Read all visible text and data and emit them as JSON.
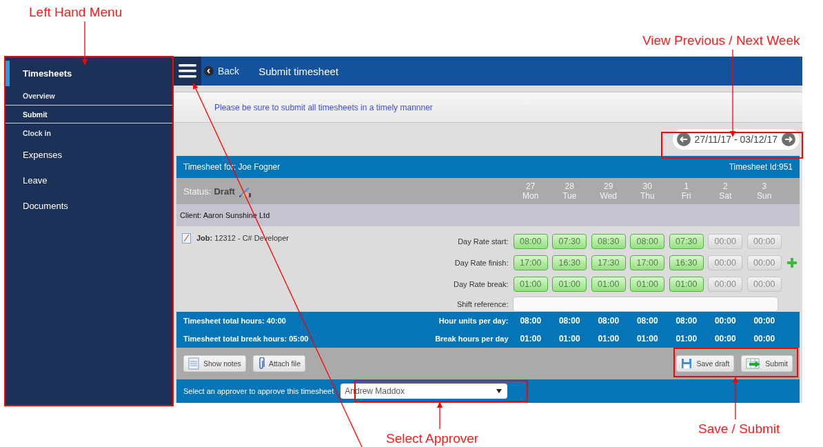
{
  "annotations": [
    {
      "text": "Left Hand Menu"
    },
    {
      "text": "View Previous / Next Week"
    },
    {
      "text": "Select Approver"
    },
    {
      "text": "Save / Submit"
    }
  ],
  "sidebar": {
    "items": [
      {
        "label": "Timesheets",
        "selected": true,
        "children": [
          {
            "label": "Overview",
            "selected": false
          },
          {
            "label": "Submit",
            "selected": true
          },
          {
            "label": "Clock in",
            "selected": false
          }
        ]
      },
      {
        "label": "Expenses",
        "selected": false
      },
      {
        "label": "Leave",
        "selected": false
      },
      {
        "label": "Documents",
        "selected": false
      }
    ]
  },
  "header": {
    "back": "Back",
    "title": "Submit timesheet"
  },
  "notice": "Please be sure to submit all timesheets in a timely mannner",
  "week": {
    "range": "27/11/17 - 03/12/17"
  },
  "timesheet": {
    "for": "Timesheet for: Joe Fogner",
    "id": "Timesheet Id:951",
    "status_label": "Status:",
    "status": "Draft",
    "client": "Client: Aaron Sunshine Ltd",
    "job": "**Job:** 12312 - C# Developer",
    "row_labels": {
      "start": "Day Rate start:",
      "finish": "Day Rate finish:",
      "break": "Day Rate break:",
      "shift": "Shift reference:"
    },
    "days": [
      {
        "num": "27",
        "name": "Mon",
        "entered": true,
        "start": "08:00",
        "finish": "17:00",
        "break": "01:00",
        "hours": "08:00",
        "break_hours": "01:00"
      },
      {
        "num": "28",
        "name": "Tue",
        "entered": true,
        "start": "07:30",
        "finish": "16:30",
        "break": "01:00",
        "hours": "08:00",
        "break_hours": "01:00"
      },
      {
        "num": "29",
        "name": "Wed",
        "entered": true,
        "start": "08:30",
        "finish": "17:30",
        "break": "01:00",
        "hours": "08:00",
        "break_hours": "01:00"
      },
      {
        "num": "30",
        "name": "Thu",
        "entered": true,
        "start": "08:00",
        "finish": "17:00",
        "break": "01:00",
        "hours": "08:00",
        "break_hours": "01:00"
      },
      {
        "num": "1",
        "name": "Fri",
        "entered": true,
        "start": "07:30",
        "finish": "16:30",
        "break": "01:00",
        "hours": "08:00",
        "break_hours": "01:00"
      },
      {
        "num": "2",
        "name": "Sat",
        "entered": false,
        "start": "00:00",
        "finish": "00:00",
        "break": "00:00",
        "hours": "00:00",
        "break_hours": "00:00"
      },
      {
        "num": "3",
        "name": "Sun",
        "entered": false,
        "start": "00:00",
        "finish": "00:00",
        "break": "00:00",
        "hours": "00:00",
        "break_hours": "00:00"
      }
    ],
    "total_hours": "Timesheet total hours: 40:00",
    "total_break": "Timesheet total break hours: 05:00",
    "hours_label": "Hour units per day:",
    "break_label": "Break hours per day",
    "left_buttons": [
      {
        "label": "Show notes",
        "kind": "notes"
      },
      {
        "label": "Attach file",
        "kind": "attach"
      }
    ],
    "right_buttons": [
      {
        "label": "Save draft",
        "kind": "save"
      },
      {
        "label": "Submit",
        "kind": "submit"
      }
    ],
    "approver_label": "Select an approver to approve this timesheet",
    "approver": "Andrew Maddox"
  }
}
